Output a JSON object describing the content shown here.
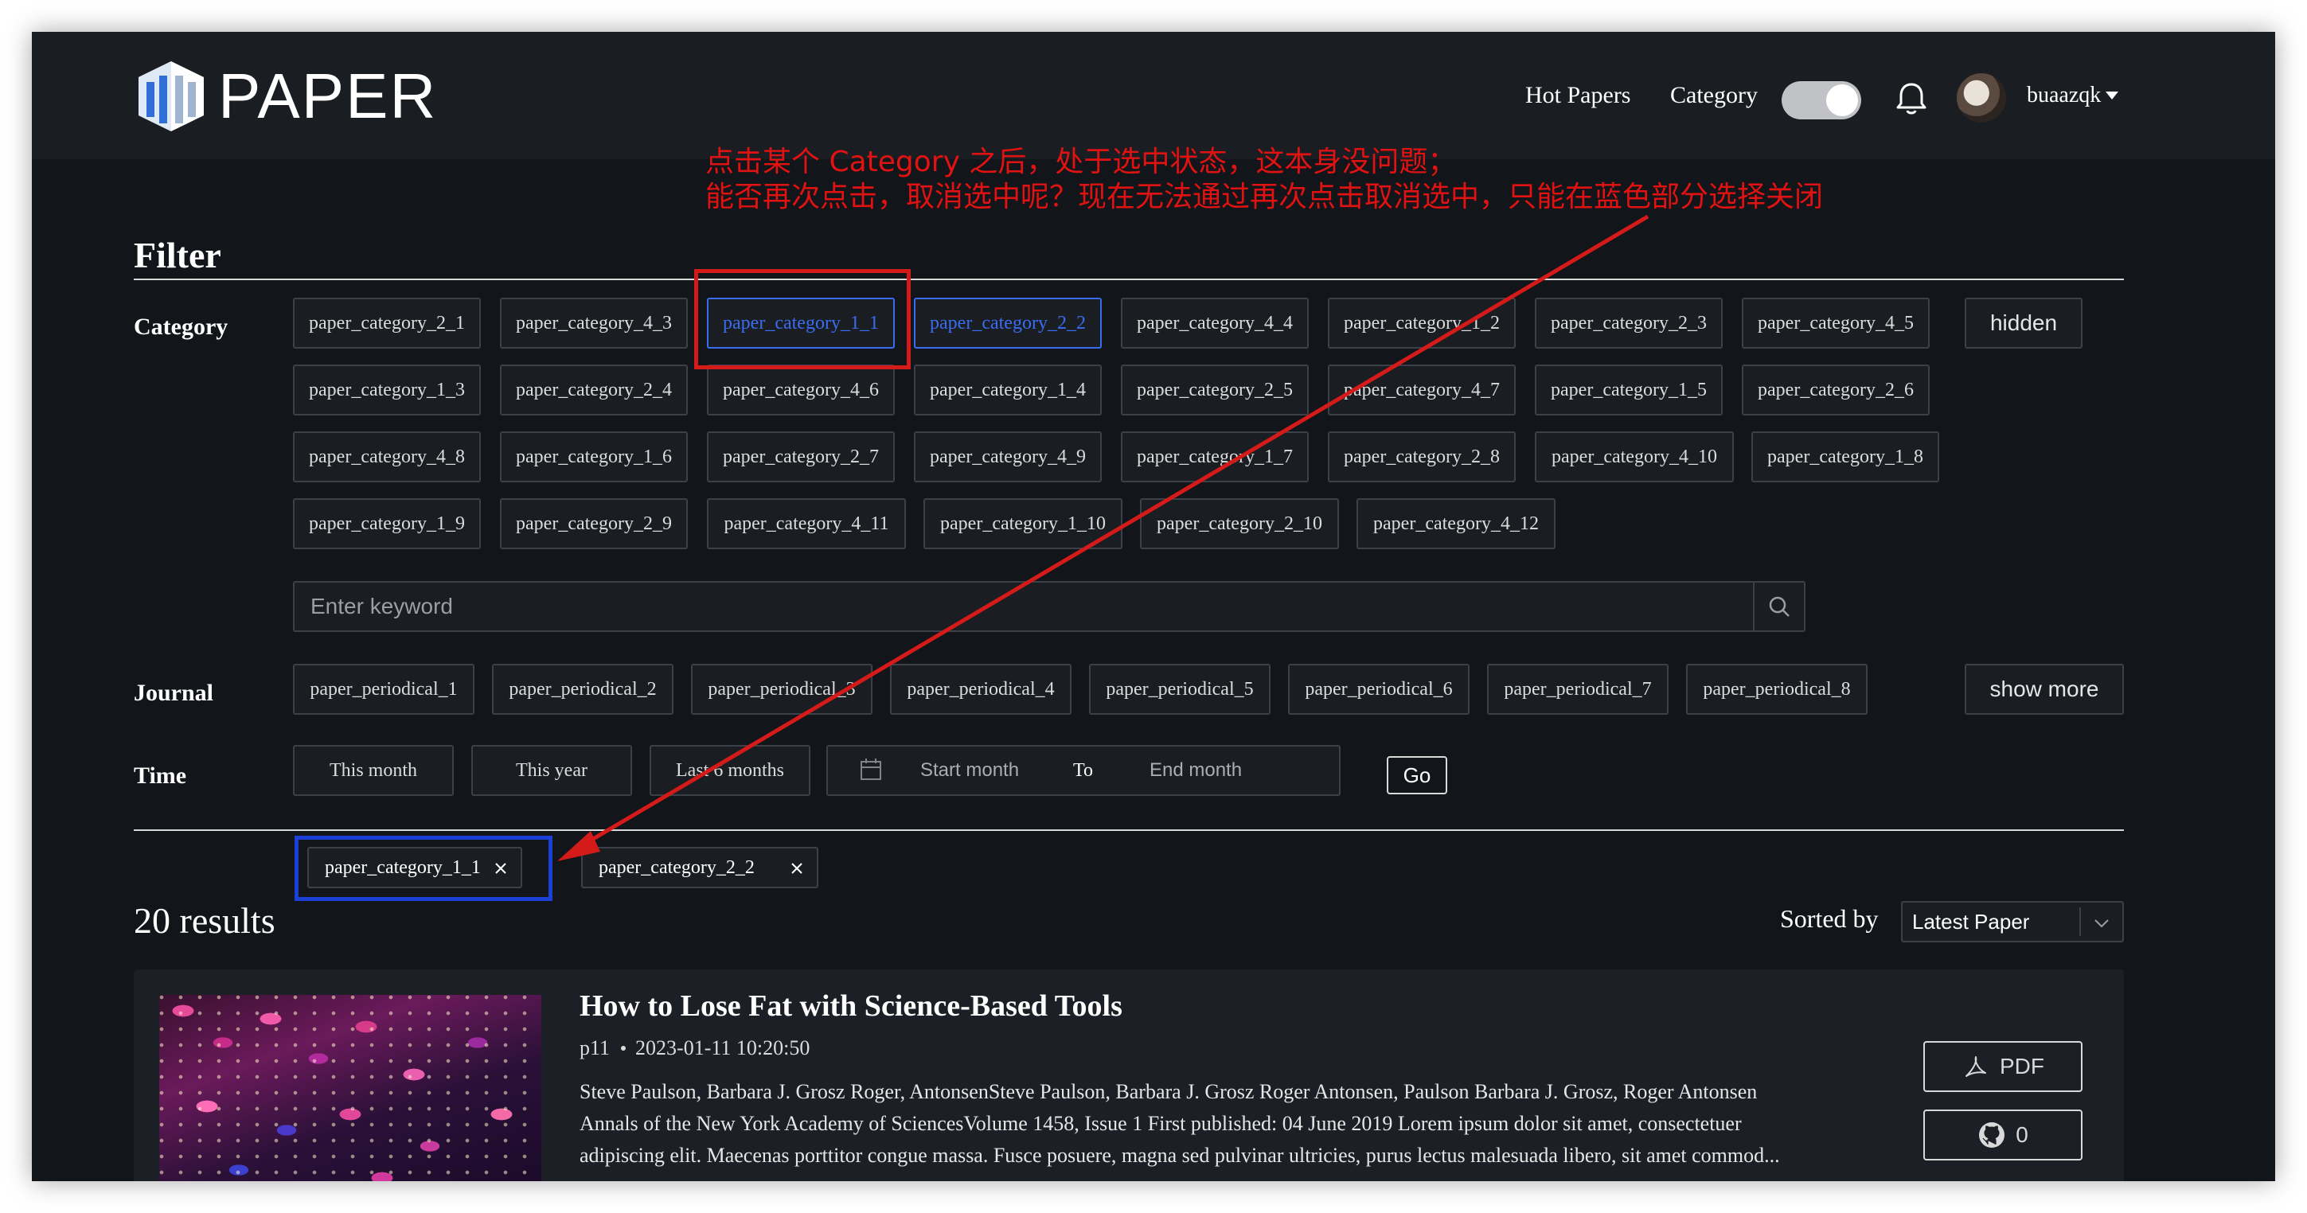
{
  "header": {
    "logo_text": "PAPER",
    "nav": [
      "Hot Papers",
      "Category"
    ],
    "toggle_on": true,
    "username": "buaazqk"
  },
  "annotation": {
    "line1": "点击某个 Category 之后，处于选中状态，这本身没问题；",
    "line2": "能否再次点击，取消选中呢？现在无法通过再次点击取消选中，只能在蓝色部分选择关闭",
    "colors": {
      "text": "#e01212",
      "red_box": "#d51a1a",
      "blue_box": "#1c3fd6"
    }
  },
  "filter": {
    "title": "Filter",
    "category_label": "Category",
    "categories": [
      [
        "paper_category_2_1",
        "paper_category_4_3",
        "paper_category_1_1",
        "paper_category_2_2",
        "paper_category_4_4",
        "paper_category_1_2",
        "paper_category_2_3",
        "paper_category_4_5"
      ],
      [
        "paper_category_1_3",
        "paper_category_2_4",
        "paper_category_4_6",
        "paper_category_1_4",
        "paper_category_2_5",
        "paper_category_4_7",
        "paper_category_1_5",
        "paper_category_2_6"
      ],
      [
        "paper_category_4_8",
        "paper_category_1_6",
        "paper_category_2_7",
        "paper_category_4_9",
        "paper_category_1_7",
        "paper_category_2_8",
        "paper_category_4_10",
        "paper_category_1_8"
      ],
      [
        "paper_category_1_9",
        "paper_category_2_9",
        "paper_category_4_11",
        "paper_category_1_10",
        "paper_category_2_10",
        "paper_category_4_12"
      ]
    ],
    "selected_categories": [
      "paper_category_1_1",
      "paper_category_2_2"
    ],
    "hidden_button": "hidden",
    "search_placeholder": "Enter keyword",
    "journal_label": "Journal",
    "journals": [
      "paper_periodical_1",
      "paper_periodical_2",
      "paper_periodical_3",
      "paper_periodical_4",
      "paper_periodical_5",
      "paper_periodical_6",
      "paper_periodical_7",
      "paper_periodical_8"
    ],
    "show_more_button": "show more",
    "time_label": "Time",
    "time_options": [
      "This month",
      "This year",
      "Last 6 months"
    ],
    "start_placeholder": "Start month",
    "to_label": "To",
    "end_placeholder": "End month",
    "go_button": "Go",
    "active_chips": [
      "paper_category_1_1",
      "paper_category_2_2"
    ],
    "accent_color": "#3a6cf0"
  },
  "results": {
    "count_text": "20 results",
    "sorted_label": "Sorted by",
    "sort_value": "Latest Paper"
  },
  "paper": {
    "title": "How to Lose Fat with Science-Based Tools",
    "author_short": "p11",
    "date": "2023-01-11 10:20:50",
    "lines": [
      "Steve Paulson, Barbara J. Grosz Roger, AntonsenSteve Paulson, Barbara J. Grosz Roger Antonsen, Paulson Barbara J. Grosz, Roger Antonsen",
      "Annals of the New York Academy of SciencesVolume 1458, Issue 1 First published: 04 June 2019 Lorem ipsum dolor sit amet, consectetuer",
      "adipiscing elit. Maecenas porttitor congue massa. Fusce posuere, magna sed pulvinar ultricies, purus lectus malesuada libero, sit amet commod..."
    ],
    "pdf_button": "PDF",
    "github_count": "0"
  }
}
